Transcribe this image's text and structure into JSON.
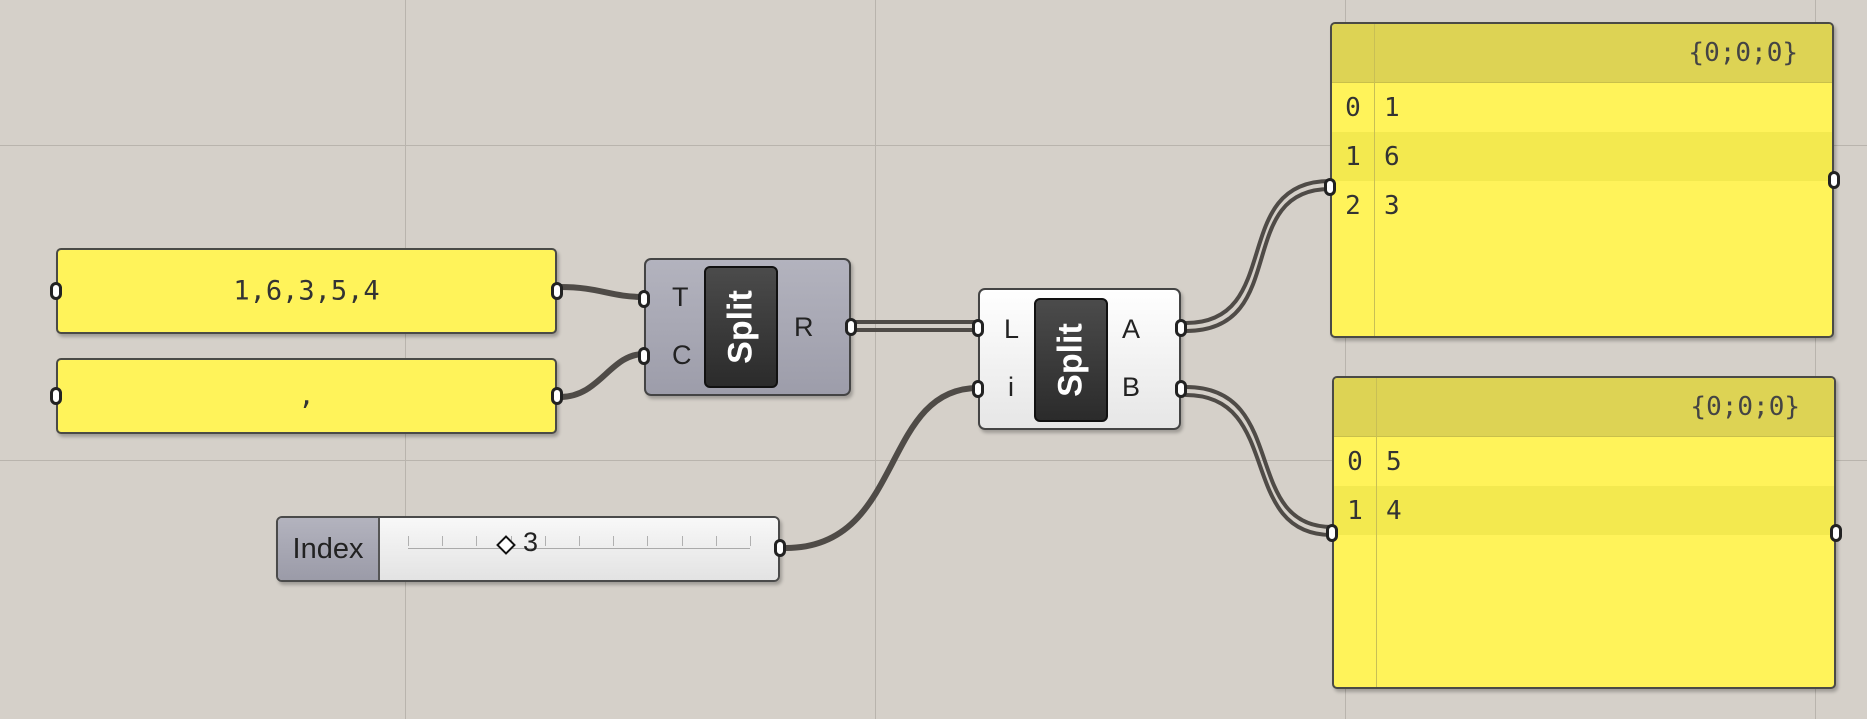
{
  "canvas": {
    "background": "#d5d0c9",
    "wire_color": "#4f4b47"
  },
  "text_panels": [
    {
      "name": "panel-text-input",
      "text": "1,6,3,5,4"
    },
    {
      "name": "panel-separator-input",
      "text": ","
    }
  ],
  "split_text": {
    "inputs": [
      "T",
      "C"
    ],
    "outputs": [
      "R"
    ],
    "title": "Split"
  },
  "split_list": {
    "inputs": [
      "L",
      "i"
    ],
    "outputs": [
      "A",
      "B"
    ],
    "title": "Split"
  },
  "index_slider": {
    "label": "Index",
    "value": "3"
  },
  "output_panels": [
    {
      "path": "{0;0;0}",
      "rows": [
        {
          "index": "0",
          "value": "1"
        },
        {
          "index": "1",
          "value": "6"
        },
        {
          "index": "2",
          "value": "3"
        }
      ]
    },
    {
      "path": "{0;0;0}",
      "rows": [
        {
          "index": "0",
          "value": "5"
        },
        {
          "index": "1",
          "value": "4"
        }
      ]
    }
  ]
}
